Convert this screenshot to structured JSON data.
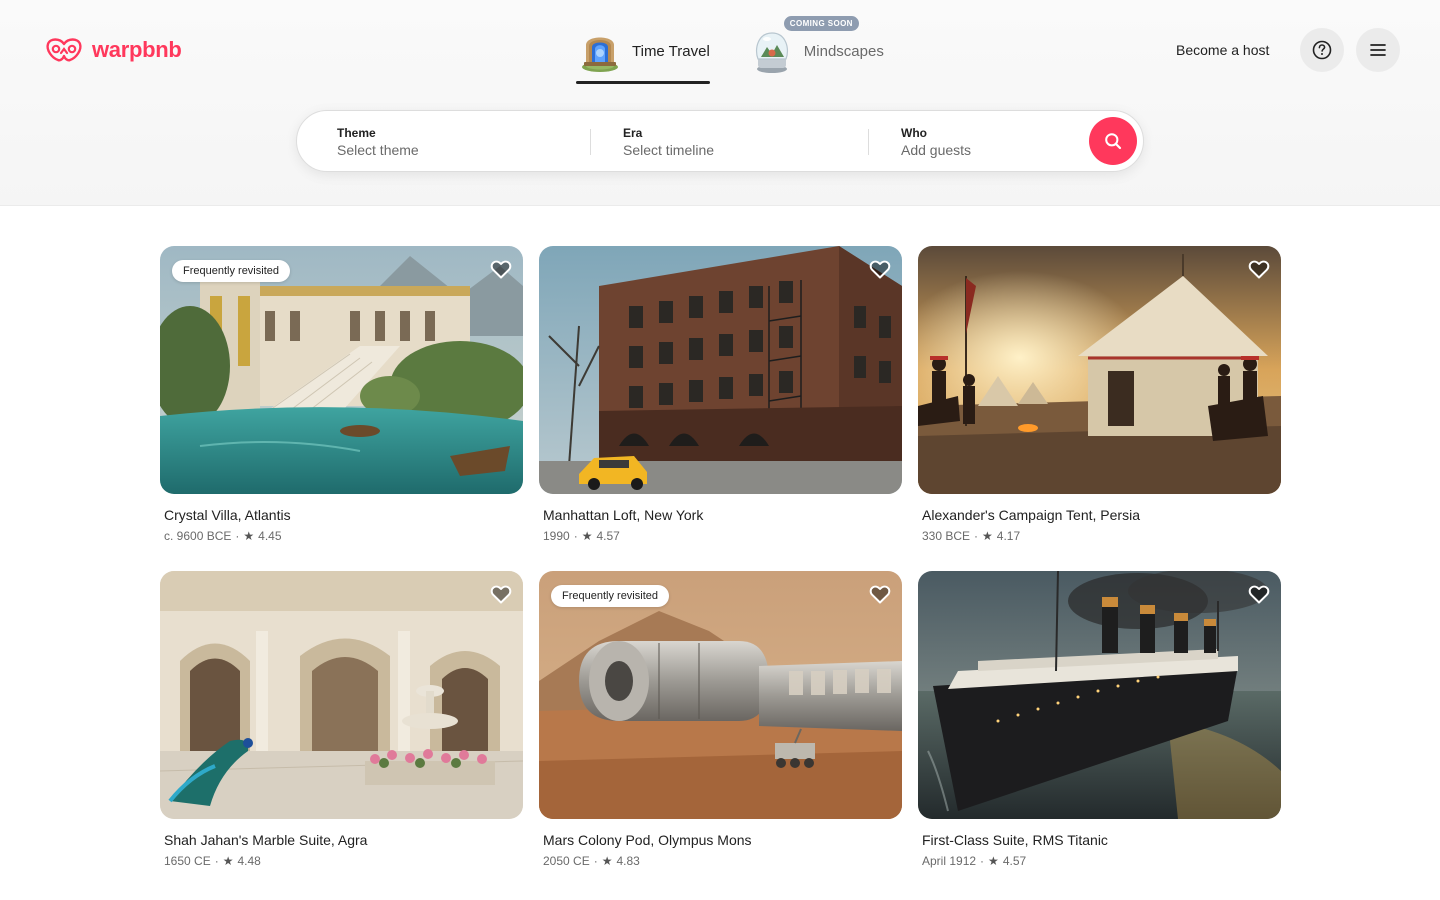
{
  "brand": {
    "name": "warpbnb",
    "color": "#ff385c"
  },
  "tabs": [
    {
      "label": "Time Travel",
      "active": true,
      "icon": "time-portal-icon"
    },
    {
      "label": "Mindscapes",
      "active": false,
      "icon": "snow-globe-icon",
      "badge": "COMING SOON"
    }
  ],
  "header": {
    "host_label": "Become a host",
    "help_icon": "question-circle-icon",
    "menu_icon": "hamburger-menu-icon"
  },
  "search": {
    "theme": {
      "label": "Theme",
      "placeholder": "Select theme"
    },
    "era": {
      "label": "Era",
      "placeholder": "Select timeline"
    },
    "who": {
      "label": "Who",
      "placeholder": "Add guests"
    },
    "button_icon": "search-icon"
  },
  "listings": [
    {
      "title": "Crystal Villa, Atlantis",
      "era": "c. 9600 BCE",
      "rating": "4.45",
      "badge": "Frequently revisited"
    },
    {
      "title": "Manhattan Loft, New York",
      "era": "1990",
      "rating": "4.57",
      "badge": ""
    },
    {
      "title": "Alexander's Campaign Tent, Persia",
      "era": "330 BCE",
      "rating": "4.17",
      "badge": ""
    },
    {
      "title": "Shah Jahan's Marble Suite, Agra",
      "era": "1650 CE",
      "rating": "4.48",
      "badge": ""
    },
    {
      "title": "Mars Colony Pod, Olympus Mons",
      "era": "2050 CE",
      "rating": "4.83",
      "badge": "Frequently revisited"
    },
    {
      "title": "First-Class Suite, RMS Titanic",
      "era": "April 1912",
      "rating": "4.57",
      "badge": ""
    }
  ],
  "separator": "·",
  "star_glyph": "★"
}
